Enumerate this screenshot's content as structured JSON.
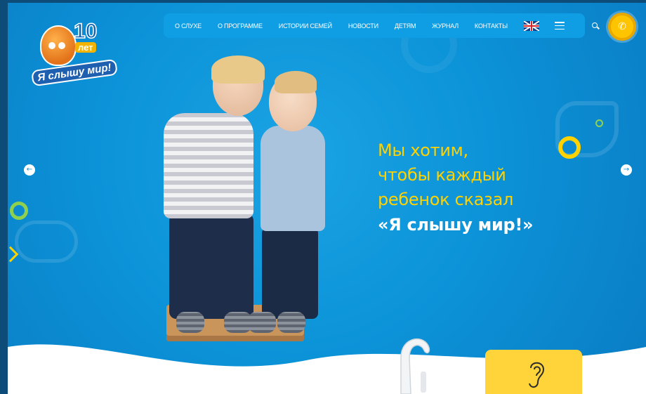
{
  "logo": {
    "number": "10",
    "years": "лет",
    "slogan": "Я слышу мир!"
  },
  "nav": {
    "items": [
      {
        "label": "О СЛУХЕ"
      },
      {
        "label": "О ПРОГРАММЕ"
      },
      {
        "label": "ИСТОРИИ СЕМЕЙ"
      },
      {
        "label": "НОВОСТИ"
      },
      {
        "label": "ДЕТЯМ"
      },
      {
        "label": "ЖУРНАЛ"
      },
      {
        "label": "КОНТАКТЫ"
      }
    ],
    "language_icon": "uk-flag-icon",
    "menu_icon": "hamburger-icon",
    "search_icon": "search-icon",
    "phone_icon": "phone-icon"
  },
  "slider": {
    "prev_icon": "arrow-left-icon",
    "next_icon": "arrow-right-icon",
    "headline": {
      "line1": "Мы хотим,",
      "line2": "чтобы каждый",
      "line3": "ребенок сказал",
      "accent": "«Я слышу мир!»"
    }
  },
  "colors": {
    "background": "#0c93d8",
    "headline_yellow": "#ffd200",
    "accent_white": "#ffffff",
    "phone_button": "#ffc400",
    "card_yellow": "#ffd43b"
  }
}
